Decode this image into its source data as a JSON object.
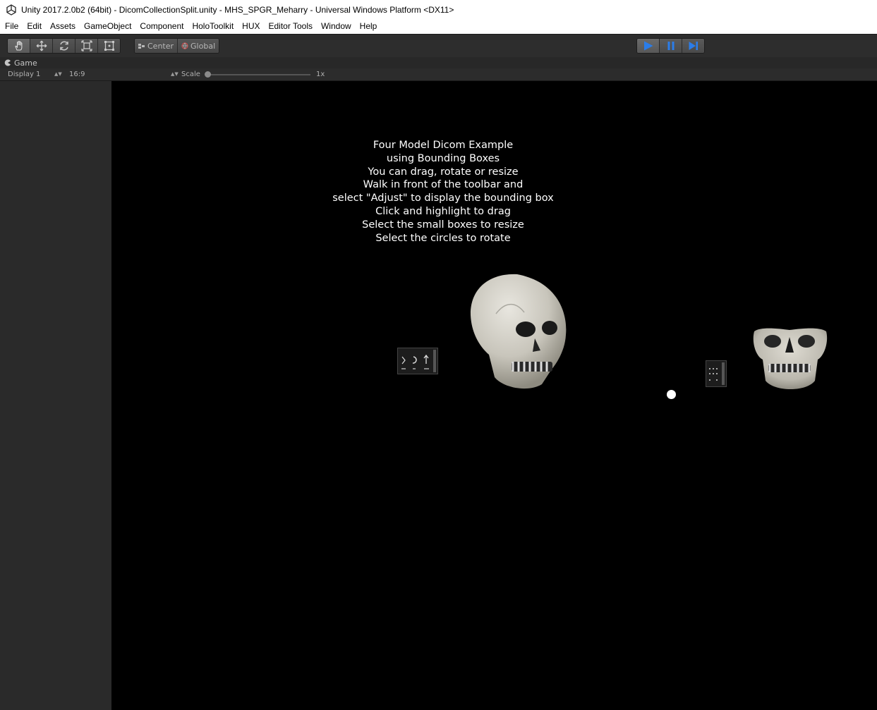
{
  "window": {
    "title": "Unity 2017.2.0b2 (64bit) - DicomCollectionSplit.unity - MHS_SPGR_Meharry - Universal Windows Platform <DX11>",
    "logo_icon": "unity-logo-icon"
  },
  "menu": [
    "File",
    "Edit",
    "Assets",
    "GameObject",
    "Component",
    "HoloToolkit",
    "HUX",
    "Editor Tools",
    "Window",
    "Help"
  ],
  "toolbar": {
    "transform_tools": [
      "hand-tool-icon",
      "move-tool-icon",
      "rotate-tool-icon",
      "scale-tool-icon",
      "rect-tool-icon"
    ],
    "active_tool": "hand-tool-icon",
    "pivot_mode": "Center",
    "pivot_rotation": "Global",
    "play_controls": [
      "play-icon",
      "pause-icon",
      "step-icon"
    ],
    "playing": true
  },
  "game_view": {
    "tab_label": "Game",
    "display": "Display 1",
    "aspect": "16:9",
    "scale_label": "Scale",
    "scale_value": "1x",
    "instructions": [
      "Four Model Dicom Example",
      "using Bounding Boxes",
      "You can drag, rotate or resize",
      "Walk in front of the toolbar and",
      "select \"Adjust\" to display the bounding box",
      "Click and highlight to drag",
      "Select the small boxes to resize",
      "Select the circles to rotate"
    ]
  },
  "colors": {
    "viewport_bg": "#000000",
    "editor_bg": "#2b2b2b",
    "play_active": "#2b7de9"
  }
}
